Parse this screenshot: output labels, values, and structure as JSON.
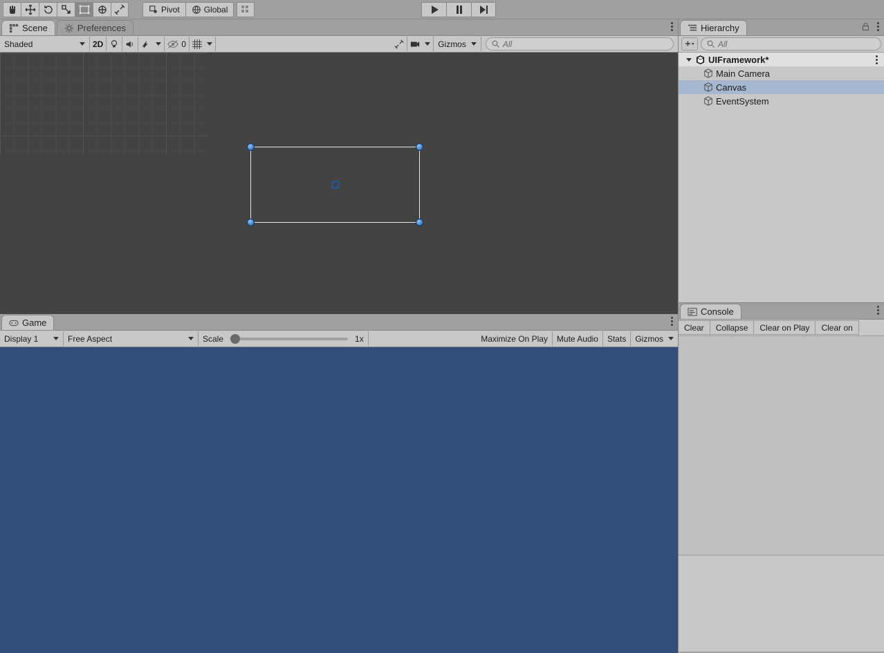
{
  "toolbar": {
    "pivot_label": "Pivot",
    "global_label": "Global"
  },
  "scene": {
    "tab_label": "Scene",
    "prefs_tab_label": "Preferences",
    "shading_mode": "Shaded",
    "two_d_label": "2D",
    "hidden_count": "0",
    "gizmos_label": "Gizmos",
    "search_placeholder": "All"
  },
  "game": {
    "tab_label": "Game",
    "display_label": "Display 1",
    "aspect_label": "Free Aspect",
    "scale_label": "Scale",
    "scale_value": "1x",
    "maximize_label": "Maximize On Play",
    "mute_label": "Mute Audio",
    "stats_label": "Stats",
    "gizmos_label": "Gizmos"
  },
  "hierarchy": {
    "tab_label": "Hierarchy",
    "search_placeholder": "All",
    "scene_name": "UIFramework*",
    "items": [
      "Main Camera",
      "Canvas",
      "EventSystem"
    ]
  },
  "console": {
    "tab_label": "Console",
    "clear_label": "Clear",
    "collapse_label": "Collapse",
    "clear_on_play_label": "Clear on Play",
    "clear_on_label": "Clear on"
  }
}
